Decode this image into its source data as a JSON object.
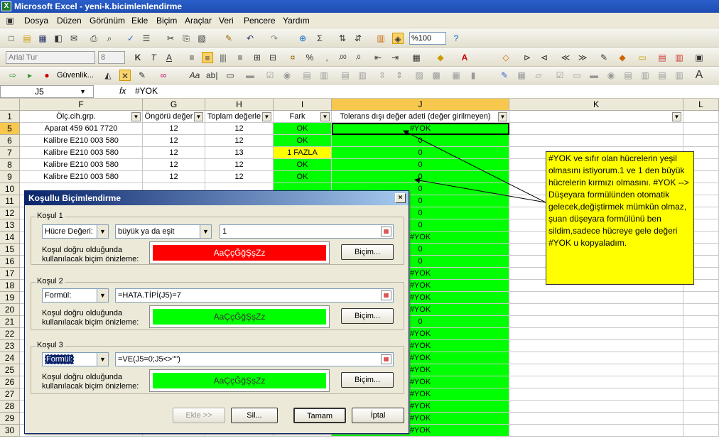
{
  "window": {
    "title": "Microsoft Excel - yeni-k.bicimlenlendirme",
    "app_icon": "X"
  },
  "menu": [
    "Dosya",
    "Düzen",
    "Görünüm",
    "Ekle",
    "Biçim",
    "Araçlar",
    "Veri",
    "Pencere",
    "Yardım"
  ],
  "toolbar": {
    "zoom": "%100",
    "font_name": "Arial Tur",
    "font_size": "8",
    "security_label": "Güvenlik..."
  },
  "formula_bar": {
    "name_box": "J5",
    "fx": "fx",
    "formula": "#YOK"
  },
  "columns": [
    {
      "name": "F"
    },
    {
      "name": "G"
    },
    {
      "name": "H"
    },
    {
      "name": "I"
    },
    {
      "name": "J"
    },
    {
      "name": "K"
    },
    {
      "name": "L"
    }
  ],
  "header_row": {
    "row": "1",
    "F": "Ölç.cih.grp.",
    "G": "Öngörü değer",
    "H": "Toplam değerle",
    "I": "Fark",
    "J": "Tolerans dışı değer adeti (değer girilmeyen)"
  },
  "rows": [
    {
      "num": "5",
      "F": "Aparat 459 601 7720",
      "G": "12",
      "H": "12",
      "I": "OK",
      "J": "#YOK",
      "Ic": "green",
      "Jc": "green"
    },
    {
      "num": "6",
      "F": "Kalibre E210 003 580",
      "G": "12",
      "H": "12",
      "I": "OK",
      "J": "0",
      "Ic": "green",
      "Jc": "green"
    },
    {
      "num": "7",
      "F": "Kalibre E210 003 580",
      "G": "12",
      "H": "13",
      "I": "1 FAZLA",
      "J": "0",
      "Ic": "yellow",
      "Jc": "green"
    },
    {
      "num": "8",
      "F": "Kalibre E210 003 580",
      "G": "12",
      "H": "12",
      "I": "OK",
      "J": "0",
      "Ic": "green",
      "Jc": "green"
    },
    {
      "num": "9",
      "F": "Kalibre E210 003 580",
      "G": "12",
      "H": "12",
      "I": "OK",
      "J": "0",
      "Ic": "green",
      "Jc": "green"
    },
    {
      "num": "10",
      "F": "",
      "G": "",
      "H": "",
      "I": "",
      "J": "0",
      "Ic": "green",
      "Jc": "green"
    },
    {
      "num": "11",
      "F": "",
      "G": "",
      "H": "",
      "I": "",
      "J": "0",
      "Ic": "",
      "Jc": "green"
    },
    {
      "num": "12",
      "F": "",
      "G": "",
      "H": "",
      "I": "",
      "J": "0",
      "Ic": "",
      "Jc": "green"
    },
    {
      "num": "13",
      "F": "",
      "G": "",
      "H": "",
      "I": "",
      "J": "0",
      "Ic": "",
      "Jc": "green"
    },
    {
      "num": "14",
      "F": "",
      "G": "",
      "H": "",
      "I": "",
      "J": "#YOK",
      "Ic": "",
      "Jc": "green"
    },
    {
      "num": "15",
      "F": "",
      "G": "",
      "H": "",
      "I": "",
      "J": "0",
      "Ic": "",
      "Jc": "green"
    },
    {
      "num": "16",
      "F": "",
      "G": "",
      "H": "",
      "I": "",
      "J": "0",
      "Ic": "",
      "Jc": "green"
    },
    {
      "num": "17",
      "F": "",
      "G": "",
      "H": "",
      "I": "",
      "J": "#YOK",
      "Ic": "",
      "Jc": "green"
    },
    {
      "num": "18",
      "F": "",
      "G": "",
      "H": "",
      "I": "",
      "J": "#YOK",
      "Ic": "",
      "Jc": "green"
    },
    {
      "num": "19",
      "F": "",
      "G": "",
      "H": "",
      "I": "",
      "J": "#YOK",
      "Ic": "",
      "Jc": "green"
    },
    {
      "num": "20",
      "F": "",
      "G": "",
      "H": "",
      "I": "",
      "J": "#YOK",
      "Ic": "",
      "Jc": "green"
    },
    {
      "num": "21",
      "F": "",
      "G": "",
      "H": "",
      "I": "",
      "J": "0",
      "Ic": "",
      "Jc": "green"
    },
    {
      "num": "22",
      "F": "",
      "G": "",
      "H": "",
      "I": "",
      "J": "#YOK",
      "Ic": "",
      "Jc": "green"
    },
    {
      "num": "23",
      "F": "",
      "G": "",
      "H": "",
      "I": "",
      "J": "#YOK",
      "Ic": "",
      "Jc": "green"
    },
    {
      "num": "24",
      "F": "",
      "G": "",
      "H": "",
      "I": "",
      "J": "#YOK",
      "Ic": "",
      "Jc": "green"
    },
    {
      "num": "25",
      "F": "",
      "G": "",
      "H": "",
      "I": "",
      "J": "#YOK",
      "Ic": "",
      "Jc": "green"
    },
    {
      "num": "26",
      "F": "",
      "G": "",
      "H": "",
      "I": "",
      "J": "#YOK",
      "Ic": "",
      "Jc": "green"
    },
    {
      "num": "27",
      "F": "",
      "G": "",
      "H": "",
      "I": "",
      "J": "#YOK",
      "Ic": "",
      "Jc": "green"
    },
    {
      "num": "28",
      "F": "",
      "G": "",
      "H": "",
      "I": "",
      "J": "#YOK",
      "Ic": "",
      "Jc": "green"
    },
    {
      "num": "29",
      "F": "",
      "G": "",
      "H": "",
      "I": "",
      "J": "#YOK",
      "Ic": "",
      "Jc": "green"
    },
    {
      "num": "30",
      "F": "",
      "G": "",
      "H": "",
      "I": "",
      "J": "#YOK",
      "Ic": "",
      "Jc": "green"
    }
  ],
  "note": {
    "text": "#YOK ve sıfır olan hücrelerin yeşil olmasını istiyorum.1 ve 1 den büyük hücrelerin kırmızı olmasını. #YOK --> Düşeyara formülünden otomatik gelecek,değiştirmek mümkün olmaz, şuan düşeyara formülünü ben sildim,sadece hücreye gele değeri #YOK u kopyaladım."
  },
  "dialog": {
    "title": "Koşullu Biçimlendirme",
    "close": "×",
    "conditions": [
      {
        "label": "Koşul 1",
        "type": "Hücre Değeri:",
        "operator": "büyük ya da eşit",
        "value": "1",
        "preview_label": "Koşul doğru olduğunda kullanılacak biçim önizleme:",
        "preview_text": "AaÇçĞğŞşZz",
        "preview_bg": "#ff0000",
        "preview_color": "#ffffff",
        "format_button": "Biçim..."
      },
      {
        "label": "Koşul 2",
        "type": "Formül:",
        "formula": "=HATA.TİPİ(J5)=7",
        "preview_label": "Koşul doğru olduğunda kullanılacak biçim önizleme:",
        "preview_text": "AaÇçĞğŞşZz",
        "preview_bg": "#00ff00",
        "preview_color": "#333333",
        "format_button": "Biçim..."
      },
      {
        "label": "Koşul 3",
        "type": "Formül:",
        "formula": "=VE(J5=0;J5<>\"\")",
        "preview_label": "Koşul doğru olduğunda kullanılacak biçim önizleme:",
        "preview_text": "AaÇçĞğŞşZz",
        "preview_bg": "#00ff00",
        "preview_color": "#333333",
        "format_button": "Biçim..."
      }
    ],
    "buttons": {
      "add": "Ekle >>",
      "delete": "Sil...",
      "ok": "Tamam",
      "cancel": "İptal"
    }
  }
}
